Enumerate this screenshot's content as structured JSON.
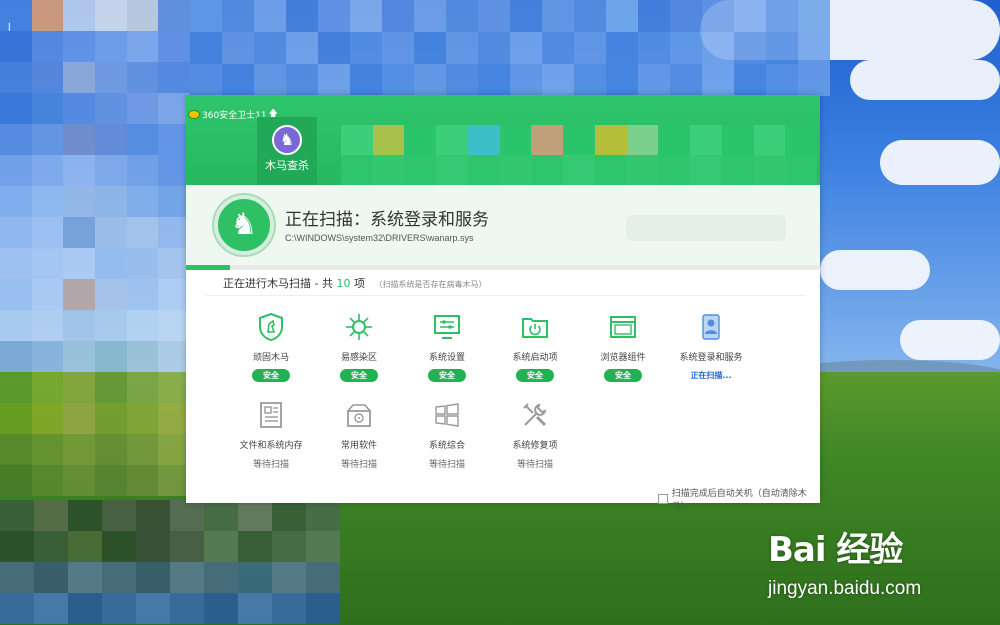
{
  "app": {
    "title": "360安全卫士11",
    "active_tab": {
      "label": "木马查杀",
      "icon": "horse-icon"
    }
  },
  "scan": {
    "title": "正在扫描：系统登录和服务",
    "current_file": "C:\\WINDOWS\\system32\\DRIVERS\\wanarp.sys",
    "progress_fraction": 0.07
  },
  "status": {
    "prefix": "正在进行木马扫描 - 共",
    "count": "10",
    "suffix": "项",
    "hint": "（扫描系统是否存在病毒木马）"
  },
  "items": [
    {
      "label": "顽固木马",
      "status": "安全",
      "state": "safe",
      "icon": "shield-horse-icon"
    },
    {
      "label": "易感染区",
      "status": "安全",
      "state": "safe",
      "icon": "virus-icon"
    },
    {
      "label": "系统设置",
      "status": "安全",
      "state": "safe",
      "icon": "monitor-settings-icon"
    },
    {
      "label": "系统启动项",
      "status": "安全",
      "state": "safe",
      "icon": "power-folder-icon"
    },
    {
      "label": "浏览器组件",
      "status": "安全",
      "state": "safe",
      "icon": "browser-window-icon"
    },
    {
      "label": "系统登录和服务",
      "status": "正在扫描...",
      "state": "scanning",
      "icon": "user-service-icon"
    },
    {
      "label": "文件和系统内存",
      "status": "等待扫描",
      "state": "waiting",
      "icon": "document-icon"
    },
    {
      "label": "常用软件",
      "status": "等待扫描",
      "state": "waiting",
      "icon": "software-box-icon"
    },
    {
      "label": "系统综合",
      "status": "等待扫描",
      "state": "waiting",
      "icon": "windows-logo-icon"
    },
    {
      "label": "系统修复项",
      "status": "等待扫描",
      "state": "waiting",
      "icon": "tools-icon"
    }
  ],
  "footer": {
    "auto_shutdown_label": "扫描完成后自动关机（自动清除木马）",
    "auto_shutdown_checked": false
  },
  "watermark": {
    "brand": "Bai 经验",
    "url": "jingyan.baidu.com"
  },
  "colors": {
    "brand_green": "#2fbf64",
    "safe_badge": "#21b251",
    "scanning_text": "#1e66d0"
  }
}
